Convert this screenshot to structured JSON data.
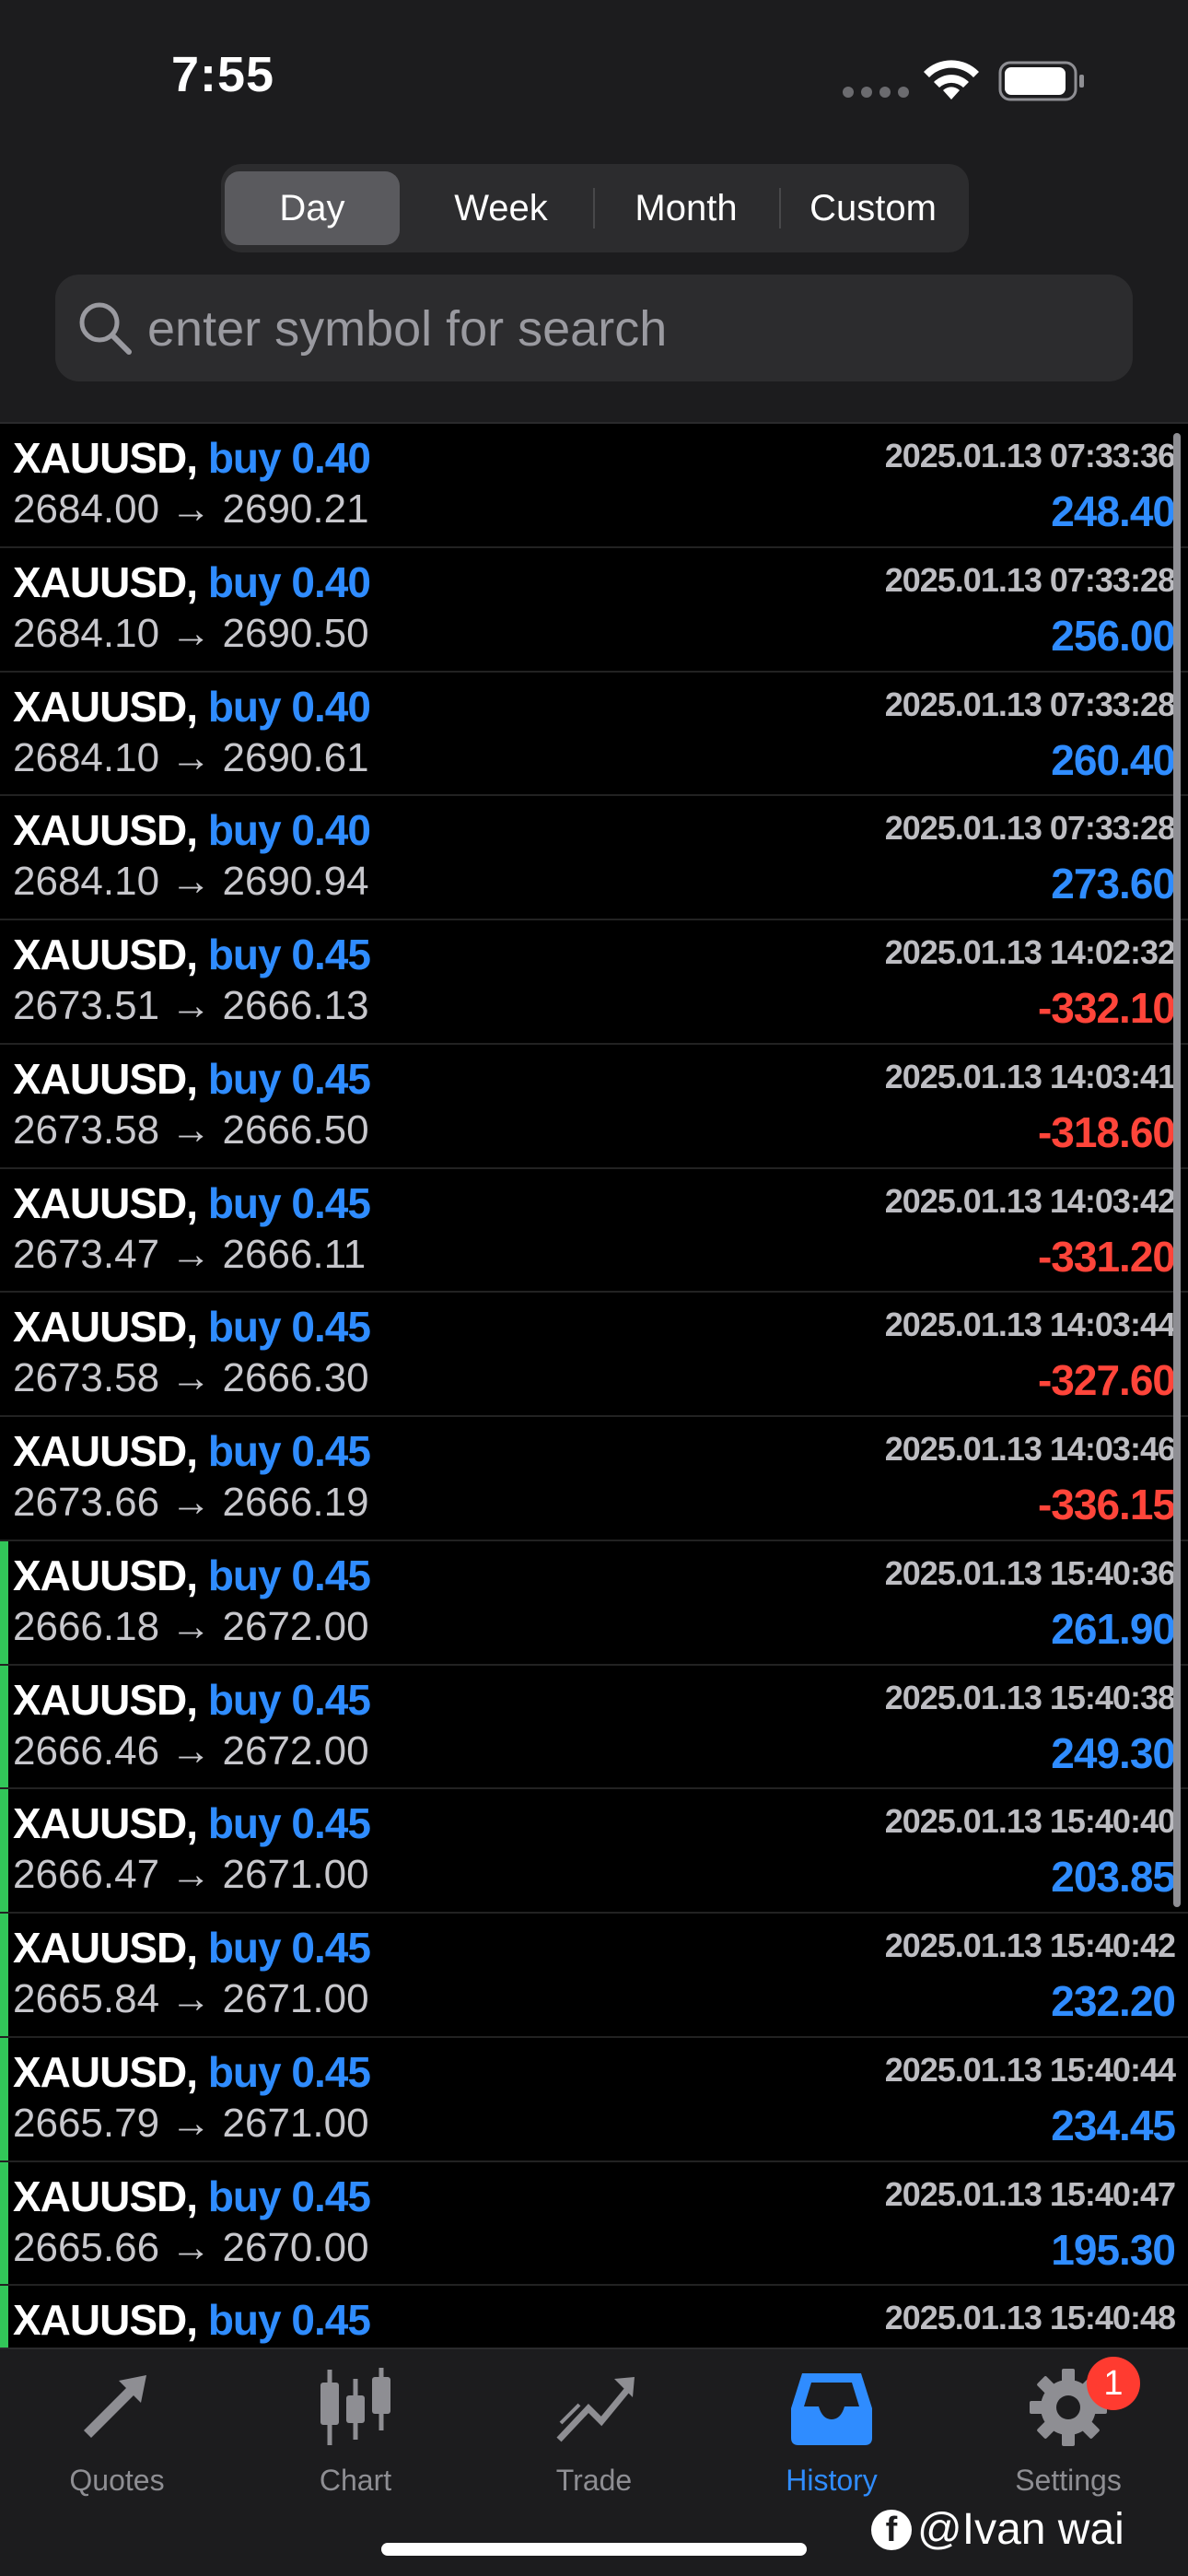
{
  "status": {
    "time": "7:55"
  },
  "segments": [
    {
      "label": "Day",
      "active": true
    },
    {
      "label": "Week",
      "active": false
    },
    {
      "label": "Month",
      "active": false
    },
    {
      "label": "Custom",
      "active": false
    }
  ],
  "search": {
    "placeholder": "enter symbol for search"
  },
  "colors": {
    "accent": "#2f8cff",
    "loss": "#ff453a",
    "profit_bar": "#32c759",
    "badge": "#ff3b30"
  },
  "trades": [
    {
      "symbol": "XAUUSD,",
      "side": "buy 0.40",
      "time": "2025.01.13 07:33:36",
      "prices": "2684.00 → 2690.21",
      "pnl": "248.40",
      "sign": "pos",
      "bar": false
    },
    {
      "symbol": "XAUUSD,",
      "side": "buy 0.40",
      "time": "2025.01.13 07:33:28",
      "prices": "2684.10 → 2690.50",
      "pnl": "256.00",
      "sign": "pos",
      "bar": false
    },
    {
      "symbol": "XAUUSD,",
      "side": "buy 0.40",
      "time": "2025.01.13 07:33:28",
      "prices": "2684.10 → 2690.61",
      "pnl": "260.40",
      "sign": "pos",
      "bar": false
    },
    {
      "symbol": "XAUUSD,",
      "side": "buy 0.40",
      "time": "2025.01.13 07:33:28",
      "prices": "2684.10 → 2690.94",
      "pnl": "273.60",
      "sign": "pos",
      "bar": false
    },
    {
      "symbol": "XAUUSD,",
      "side": "buy 0.45",
      "time": "2025.01.13 14:02:32",
      "prices": "2673.51 → 2666.13",
      "pnl": "-332.10",
      "sign": "neg",
      "bar": false
    },
    {
      "symbol": "XAUUSD,",
      "side": "buy 0.45",
      "time": "2025.01.13 14:03:41",
      "prices": "2673.58 → 2666.50",
      "pnl": "-318.60",
      "sign": "neg",
      "bar": false
    },
    {
      "symbol": "XAUUSD,",
      "side": "buy 0.45",
      "time": "2025.01.13 14:03:42",
      "prices": "2673.47 → 2666.11",
      "pnl": "-331.20",
      "sign": "neg",
      "bar": false
    },
    {
      "symbol": "XAUUSD,",
      "side": "buy 0.45",
      "time": "2025.01.13 14:03:44",
      "prices": "2673.58 → 2666.30",
      "pnl": "-327.60",
      "sign": "neg",
      "bar": false
    },
    {
      "symbol": "XAUUSD,",
      "side": "buy 0.45",
      "time": "2025.01.13 14:03:46",
      "prices": "2673.66 → 2666.19",
      "pnl": "-336.15",
      "sign": "neg",
      "bar": false
    },
    {
      "symbol": "XAUUSD,",
      "side": "buy 0.45",
      "time": "2025.01.13 15:40:36",
      "prices": "2666.18 → 2672.00",
      "pnl": "261.90",
      "sign": "pos",
      "bar": true
    },
    {
      "symbol": "XAUUSD,",
      "side": "buy 0.45",
      "time": "2025.01.13 15:40:38",
      "prices": "2666.46 → 2672.00",
      "pnl": "249.30",
      "sign": "pos",
      "bar": true
    },
    {
      "symbol": "XAUUSD,",
      "side": "buy 0.45",
      "time": "2025.01.13 15:40:40",
      "prices": "2666.47 → 2671.00",
      "pnl": "203.85",
      "sign": "pos",
      "bar": true
    },
    {
      "symbol": "XAUUSD,",
      "side": "buy 0.45",
      "time": "2025.01.13 15:40:42",
      "prices": "2665.84 → 2671.00",
      "pnl": "232.20",
      "sign": "pos",
      "bar": true
    },
    {
      "symbol": "XAUUSD,",
      "side": "buy 0.45",
      "time": "2025.01.13 15:40:44",
      "prices": "2665.79 → 2671.00",
      "pnl": "234.45",
      "sign": "pos",
      "bar": true
    },
    {
      "symbol": "XAUUSD,",
      "side": "buy 0.45",
      "time": "2025.01.13 15:40:47",
      "prices": "2665.66 → 2670.00",
      "pnl": "195.30",
      "sign": "pos",
      "bar": true
    },
    {
      "symbol": "XAUUSD,",
      "side": "buy 0.45",
      "time": "2025.01.13 15:40:48",
      "prices": "",
      "pnl": "",
      "sign": "pos",
      "bar": true
    }
  ],
  "tabs": [
    {
      "label": "Quotes",
      "icon": "quotes-arrows-icon",
      "active": false
    },
    {
      "label": "Chart",
      "icon": "candlestick-chart-icon",
      "active": false
    },
    {
      "label": "Trade",
      "icon": "trend-line-icon",
      "active": false
    },
    {
      "label": "History",
      "icon": "inbox-tray-icon",
      "active": true
    },
    {
      "label": "Settings",
      "icon": "gear-icon",
      "active": false
    }
  ],
  "settings_badge": "1",
  "watermark": {
    "logo": "f",
    "text": "@Ivan wai"
  }
}
